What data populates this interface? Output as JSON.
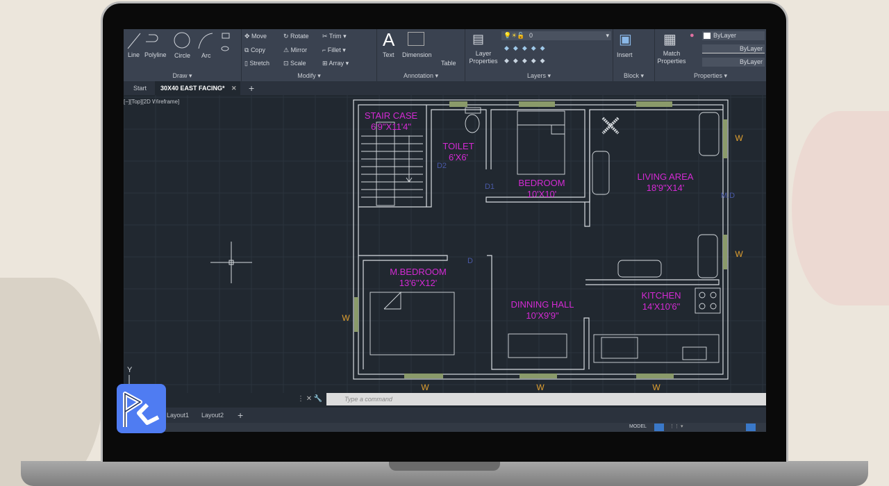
{
  "ribbon": {
    "draw": {
      "label": "Draw ▾",
      "items": [
        "Line",
        "Polyline",
        "Circle",
        "Arc"
      ]
    },
    "modify": {
      "label": "Modify ▾",
      "items": [
        "Move",
        "Rotate",
        "Trim",
        "Copy",
        "Mirror",
        "Fillet",
        "Stretch",
        "Scale",
        "Array"
      ]
    },
    "annotation": {
      "label": "Annotation ▾",
      "items": [
        "Text",
        "Dimension",
        "Table"
      ]
    },
    "layers": {
      "label": "Layers ▾",
      "layer_properties": "Layer Properties",
      "current_layer": "0"
    },
    "block": {
      "label": "Block ▾",
      "insert": "Insert"
    },
    "properties": {
      "label": "Properties ▾",
      "match": "Match Properties",
      "color": "ByLayer",
      "lineweight": "ByLayer",
      "linetype": "ByLayer"
    }
  },
  "tabs": [
    {
      "label": "Start"
    },
    {
      "label": "30X40 EAST FACING*"
    }
  ],
  "viewport_label": "[−][Top][2D Wireframe]",
  "drawing": {
    "rooms": [
      {
        "name": "STAIR CASE",
        "size": "6'9\"X11'4\""
      },
      {
        "name": "TOILET",
        "size": "6'X6'"
      },
      {
        "name": "BEDROOM",
        "size": "10'X10'"
      },
      {
        "name": "LIVING AREA",
        "size": "18'9\"X14'"
      },
      {
        "name": "M.BEDROOM",
        "size": "13'6\"X12'"
      },
      {
        "name": "DINNING HALL",
        "size": "10'X9'9\""
      },
      {
        "name": "KITCHEN",
        "size": "14'X10'6\""
      }
    ],
    "markers": {
      "window": "W",
      "door": "D",
      "door1": "D1",
      "door2": "D2",
      "main_door": "M.D",
      "ucs_y": "Y"
    },
    "colors": {
      "room_text": "#d42ad4",
      "window_text": "#e0a030",
      "door_text": "#4a5aa8",
      "walls": "#d8dce0",
      "window": "#8a9a6a"
    }
  },
  "command": {
    "placeholder": "Type a command"
  },
  "layouts": [
    "Layout1",
    "Layout2"
  ],
  "status": {
    "model": "MODEL"
  },
  "logo": "PC"
}
